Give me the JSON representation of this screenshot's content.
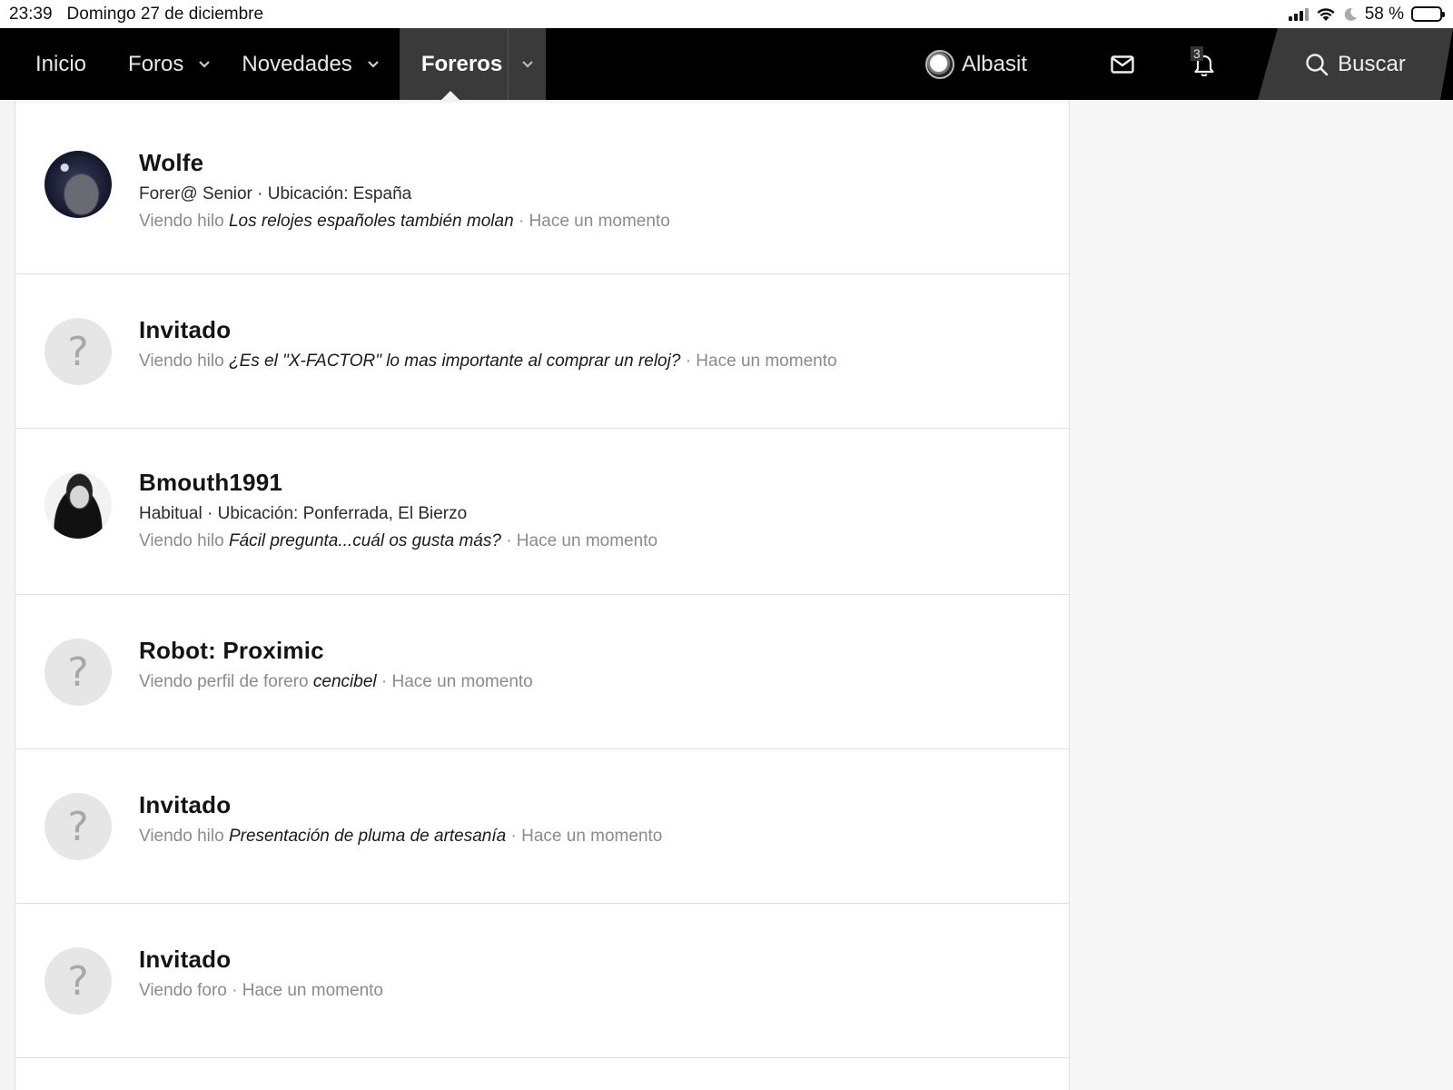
{
  "status_bar": {
    "time": "23:39",
    "date": "Domingo 27 de diciembre",
    "battery": "58 %",
    "battery_level": 0.58
  },
  "nav": {
    "home": "Inicio",
    "forums": "Foros",
    "news": "Novedades",
    "members": "Foreros",
    "username": "Albasit",
    "notifications_count": "3",
    "search": "Buscar"
  },
  "members": [
    {
      "name": "Wolfe",
      "meta": "Forer@ Senior · Ubicación: España",
      "action": "Viendo hilo",
      "target": "Los relojes españoles también molan",
      "time": "· Hace un momento",
      "avatar": "photo"
    },
    {
      "name": "Invitado",
      "meta": "",
      "action": "Viendo hilo",
      "target": "¿Es el \"X-FACTOR\" lo mas importante al comprar un reloj?",
      "time": "· Hace un momento",
      "avatar": "?"
    },
    {
      "name": "Bmouth1991",
      "meta": "Habitual · Ubicación: Ponferrada, El Bierzo",
      "action": "Viendo hilo",
      "target": "Fácil pregunta...cuál os gusta más?",
      "time": "· Hace un momento",
      "avatar": "photo"
    },
    {
      "name": "Robot: Proximic",
      "meta": "",
      "action": "Viendo perfil de forero",
      "target": "cencibel",
      "time": "· Hace un momento",
      "avatar": "?"
    },
    {
      "name": "Invitado",
      "meta": "",
      "action": "Viendo hilo",
      "target": "Presentación de pluma de artesanía",
      "time": "· Hace un momento",
      "avatar": "?"
    },
    {
      "name": "Invitado",
      "meta": "",
      "action": "Viendo foro",
      "target": "",
      "time": "· Hace un momento",
      "avatar": "?"
    }
  ]
}
